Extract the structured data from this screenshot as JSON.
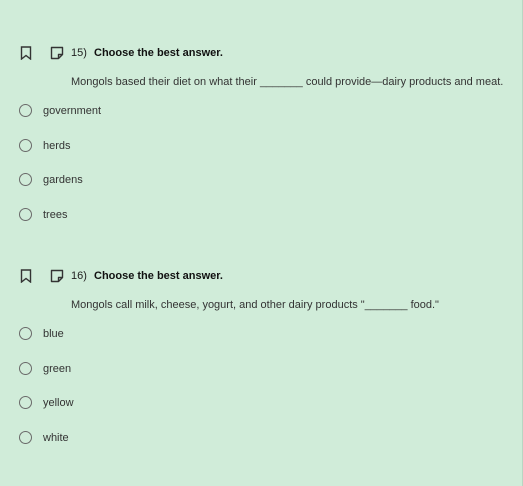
{
  "questions": [
    {
      "number": "15)",
      "title": "Choose the best answer.",
      "text": "Mongols based their diet on what their _______ could provide—dairy products and meat.",
      "choices": [
        "government",
        "herds",
        "gardens",
        "trees"
      ]
    },
    {
      "number": "16)",
      "title": "Choose the best answer.",
      "text": "Mongols call milk, cheese, yogurt, and other dairy products \"_______ food.\"",
      "choices": [
        "blue",
        "green",
        "yellow",
        "white"
      ]
    }
  ],
  "icons": {
    "bookmark": "bookmark-icon",
    "note": "note-icon"
  },
  "colors": {
    "background": "#d0ecd9",
    "radio_border": "#6a6a6a"
  }
}
